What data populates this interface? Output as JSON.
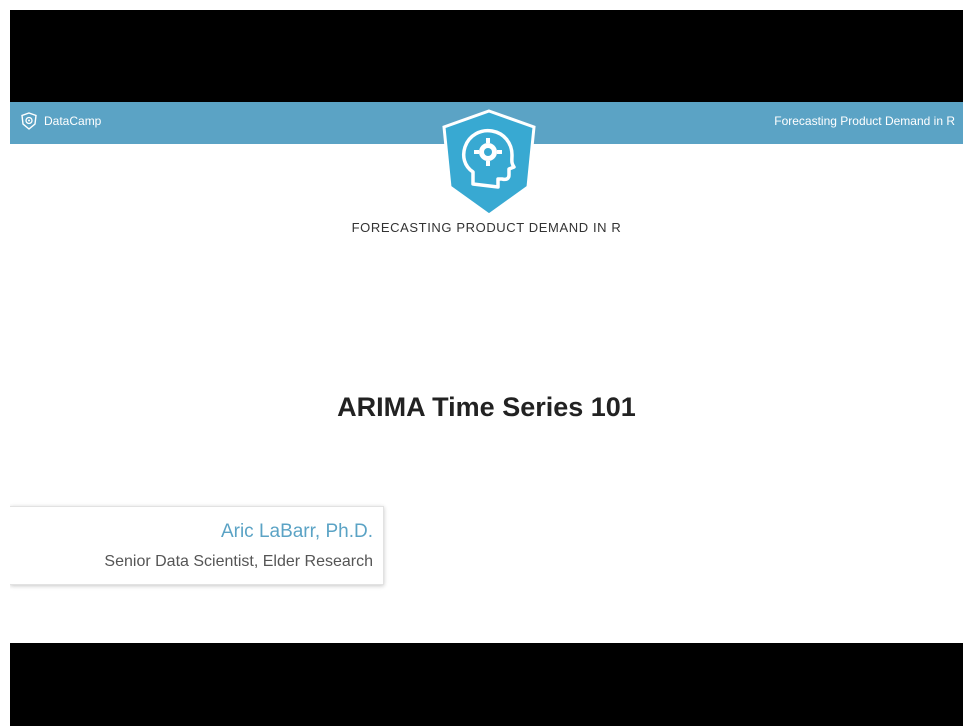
{
  "header": {
    "brand_label": "DataCamp",
    "course_label": "Forecasting Product Demand in R"
  },
  "main": {
    "course_title": "FORECASTING PRODUCT DEMAND IN R",
    "lesson_title": "ARIMA Time Series 101"
  },
  "presenter": {
    "name": "Aric LaBarr, Ph.D.",
    "role": "Senior Data Scientist, Elder Research"
  },
  "icons": {
    "brand": "datacamp-shield-icon",
    "badge": "course-head-gear-badge-icon"
  },
  "colors": {
    "accent": "#5ba3c5",
    "letterbox": "#000000",
    "background": "#ffffff"
  }
}
